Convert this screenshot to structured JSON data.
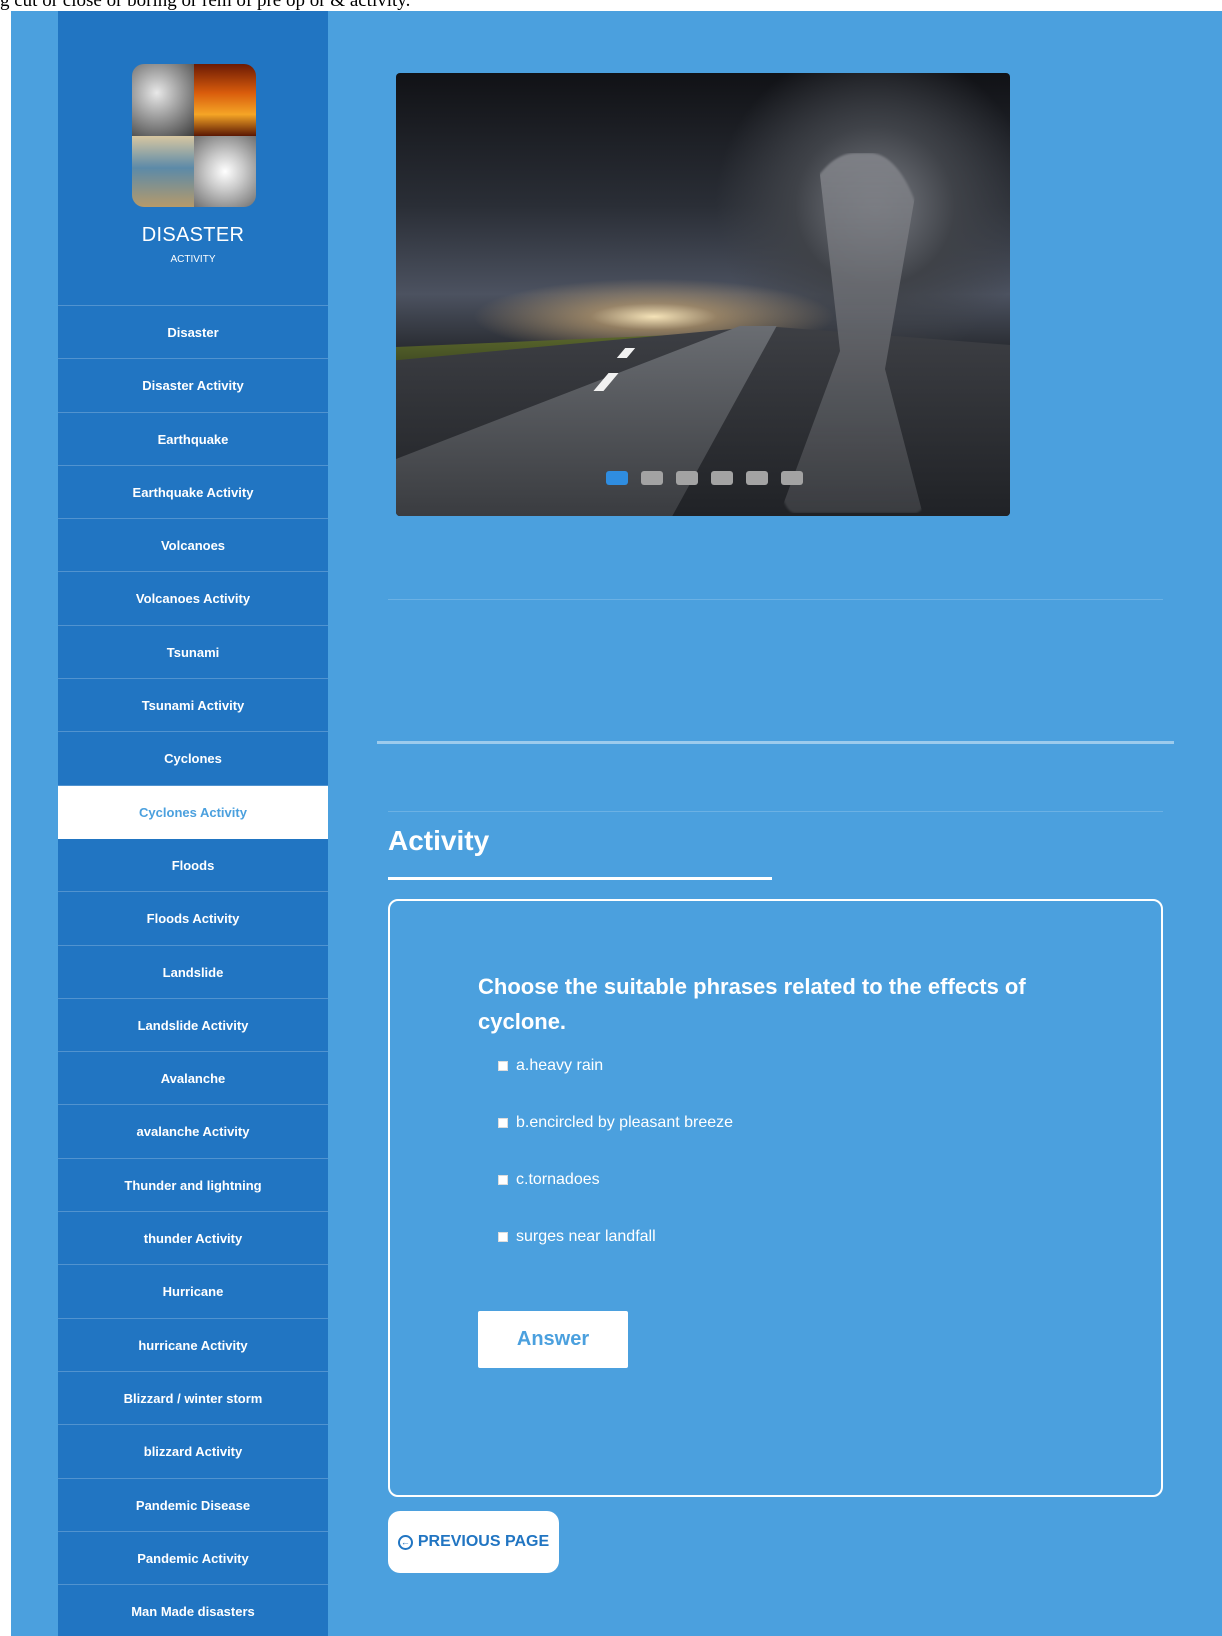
{
  "top_text": "g cut or close or boring or rem of pre op or & activity.",
  "sidebar": {
    "brand_title": "DISASTER",
    "brand_subtitle": "ACTIVITY",
    "items": [
      {
        "label": "Disaster"
      },
      {
        "label": "Disaster Activity"
      },
      {
        "label": "Earthquake"
      },
      {
        "label": "Earthquake Activity"
      },
      {
        "label": "Volcanoes"
      },
      {
        "label": "Volcanoes Activity"
      },
      {
        "label": "Tsunami"
      },
      {
        "label": "Tsunami Activity"
      },
      {
        "label": "Cyclones"
      },
      {
        "label": "Cyclones Activity",
        "active": true
      },
      {
        "label": "Floods"
      },
      {
        "label": "Floods Activity"
      },
      {
        "label": "Landslide"
      },
      {
        "label": "Landslide Activity"
      },
      {
        "label": "Avalanche"
      },
      {
        "label": "avalanche Activity"
      },
      {
        "label": "Thunder and lightning"
      },
      {
        "label": "thunder Activity"
      },
      {
        "label": "Hurricane"
      },
      {
        "label": "hurricane Activity"
      },
      {
        "label": "Blizzard / winter storm"
      },
      {
        "label": "blizzard Activity"
      },
      {
        "label": "Pandemic Disease"
      },
      {
        "label": "Pandemic Activity"
      },
      {
        "label": "Man Made disasters"
      }
    ]
  },
  "slider": {
    "slide_count": 6,
    "active_index": 0
  },
  "activity": {
    "heading": "Activity",
    "question": "Choose the suitable phrases related to the effects of cyclone.",
    "options": [
      {
        "label": "a.heavy rain",
        "checked": false
      },
      {
        "label": "b.encircled by pleasant breeze",
        "checked": false
      },
      {
        "label": "c.tornadoes",
        "checked": false
      },
      {
        "label": "surges near landfall",
        "checked": false
      }
    ],
    "answer_label": "Answer"
  },
  "prev_page_label": "PREVIOUS PAGE",
  "colors": {
    "page_bg": "#4ba0de",
    "sidebar_bg": "#2175c2",
    "active_dot": "#2f8de0"
  }
}
